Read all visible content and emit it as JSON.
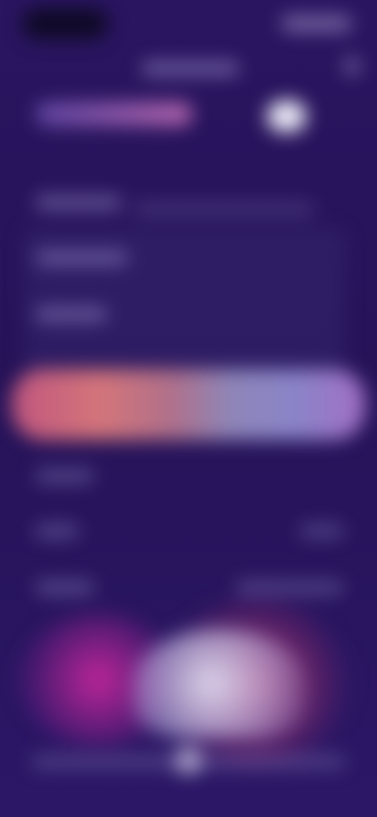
{
  "screen": {
    "title": "",
    "note_text": ""
  },
  "colors": {
    "background": "#2a1660",
    "accent_pink": "#d4757a",
    "accent_violet": "#8a84c8",
    "toggle": "#ecebf7"
  },
  "icons": {
    "status_left": "status-pill-icon",
    "status_right": "status-icons",
    "header_action": "header-action-icon"
  }
}
